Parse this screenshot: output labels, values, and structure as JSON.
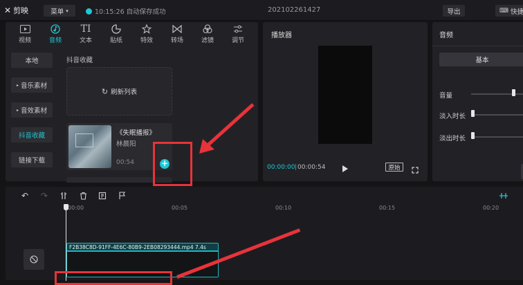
{
  "titlebar": {
    "app_name": "剪映",
    "menu_label": "菜单",
    "save_status": "10:15:26 自动保存成功",
    "project_name": "202102261427",
    "export_label": "导出",
    "shortcut_label": "快捷"
  },
  "media_panel": {
    "tabs": [
      {
        "label": "视频",
        "icon": "video-icon"
      },
      {
        "label": "音频",
        "icon": "audio-icon"
      },
      {
        "label": "文本",
        "icon": "text-icon"
      },
      {
        "label": "贴纸",
        "icon": "sticker-icon"
      },
      {
        "label": "特效",
        "icon": "effects-icon"
      },
      {
        "label": "转场",
        "icon": "transition-icon"
      },
      {
        "label": "滤镜",
        "icon": "filter-icon"
      },
      {
        "label": "调节",
        "icon": "adjust-icon"
      }
    ],
    "active_tab": "音频",
    "side_nav": [
      "本地",
      "音乐素材",
      "音效素材",
      "抖音收藏",
      "链接下载"
    ],
    "active_side": "抖音收藏",
    "section_title": "抖音收藏",
    "refresh_label": "刷新列表",
    "card": {
      "title": "《失眠播报》",
      "artist": "林晨阳",
      "duration": "00:54"
    }
  },
  "player": {
    "title": "播放器",
    "current_time": "00:00:00",
    "separator": "|",
    "total_time": "00:00:54",
    "ratio_label": "原始"
  },
  "properties": {
    "title": "音频",
    "basic_tab": "基本",
    "volume_label": "音量",
    "fade_in_label": "淡入时长",
    "fade_out_label": "淡出时长",
    "volume_level": 0.95,
    "fade_in_level": 0.0,
    "fade_out_level": 0.0
  },
  "timeline": {
    "ticks": [
      "00:00",
      "00:05",
      "00:10",
      "00:15",
      "00:20"
    ],
    "clip_name": "F2B38C8D-91FF-4E6C-80B9-2EB08293444.mp4",
    "clip_duration": "7.4s"
  },
  "colors": {
    "accent": "#1fc7d4",
    "annotation": "#e8333a"
  }
}
